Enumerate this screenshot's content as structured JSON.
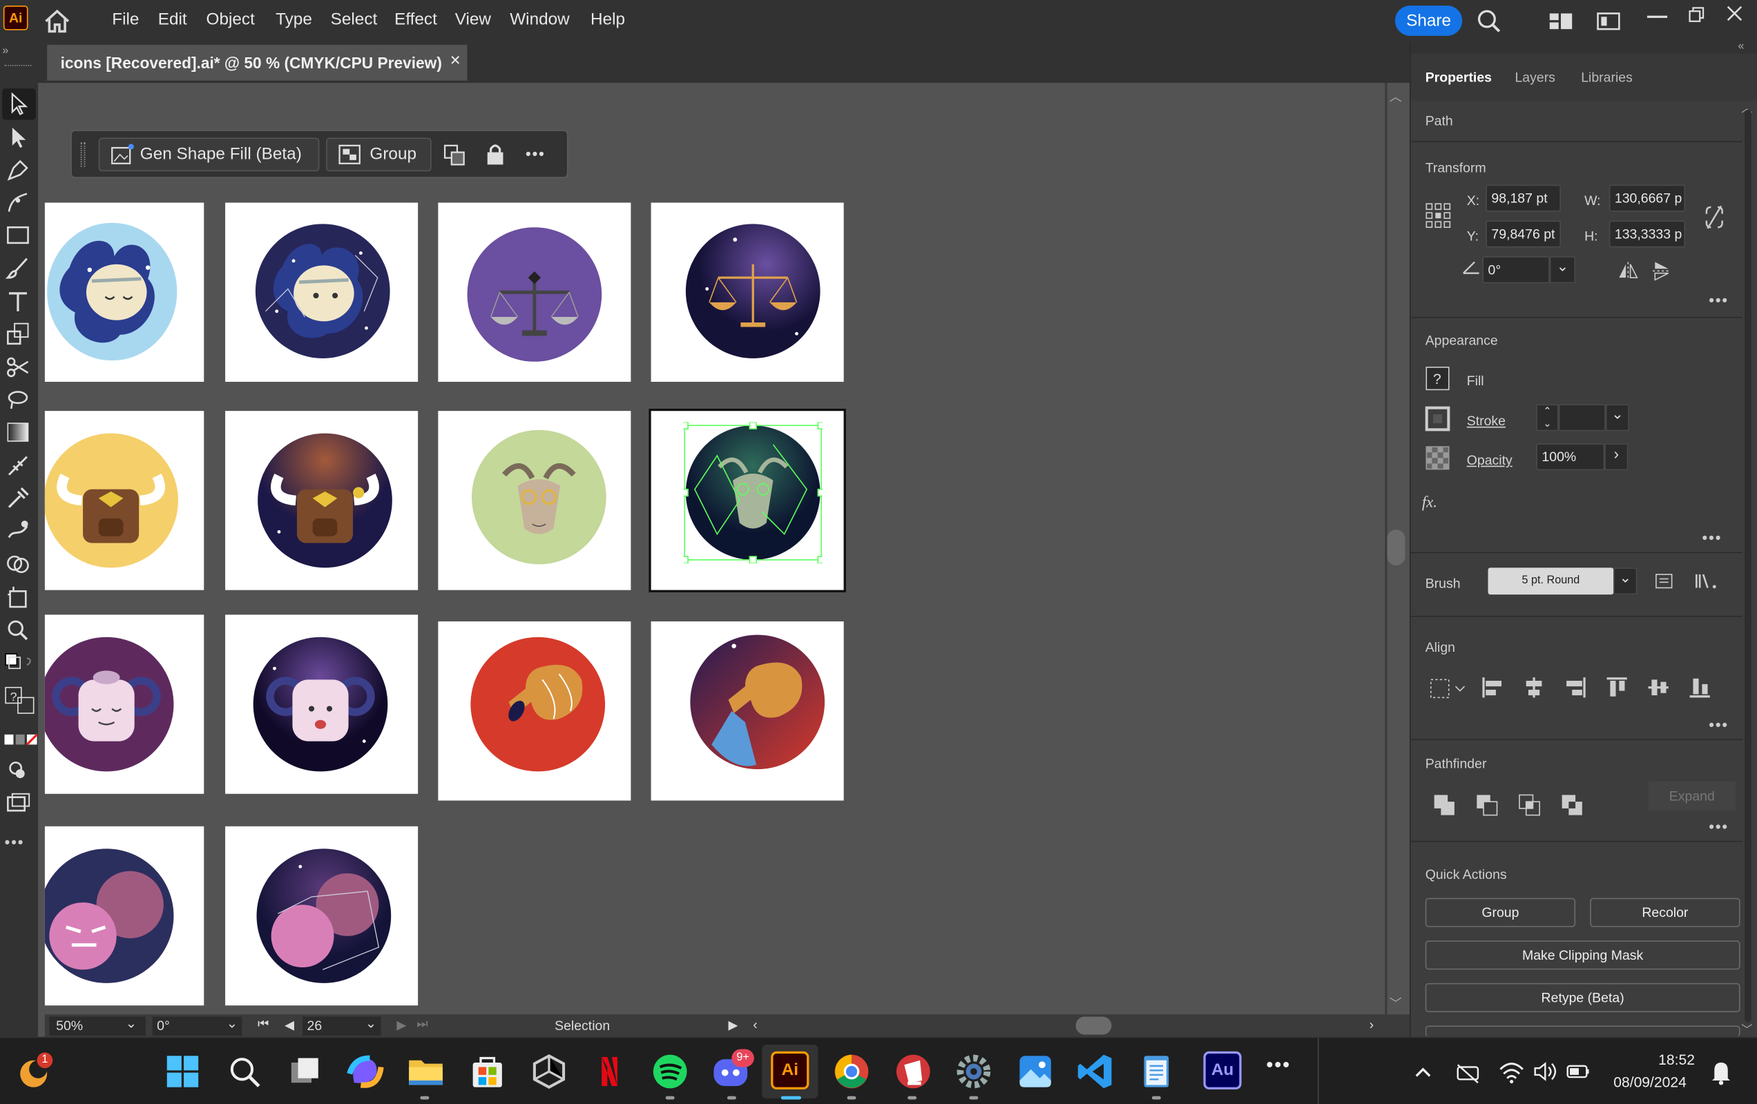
{
  "app": {
    "logo": "Ai",
    "home_icon": "home-icon"
  },
  "menu": [
    "File",
    "Edit",
    "Object",
    "Type",
    "Select",
    "Effect",
    "View",
    "Window",
    "Help"
  ],
  "header": {
    "share": "Share"
  },
  "doc_tab": {
    "title": "icons [Recovered].ai* @ 50 % (CMYK/CPU Preview)",
    "close": "×"
  },
  "context_bar": {
    "gen_shape_fill": "Gen Shape Fill (Beta)",
    "group": "Group",
    "more": "•••"
  },
  "artboards": [
    {
      "bg": "#a8d8f0",
      "fg": "#2a3d8f",
      "motif": "gemini"
    },
    {
      "bg": "#262659",
      "fg": "#2a3d8f",
      "motif": "gemini-night"
    },
    {
      "bg": "#6b4fa0",
      "fg": "#c9c9c9",
      "motif": "libra"
    },
    {
      "bg": "#2a1e52",
      "fg": "#e0a24a",
      "motif": "libra-night"
    },
    {
      "bg": "#f5cf6a",
      "fg": "#7a4a2a",
      "motif": "taurus"
    },
    {
      "bg": "#2b2255",
      "fg": "#7a4a2a",
      "motif": "taurus-night"
    },
    {
      "bg": "#c4d89a",
      "fg": "#c6b29a",
      "motif": "capricorn"
    },
    {
      "bg": "#163a3a",
      "fg": "#a7b59a",
      "motif": "capricorn-night"
    },
    {
      "bg": "#5e2a5e",
      "fg": "#f1d9e8",
      "motif": "aries"
    },
    {
      "bg": "#2b2050",
      "fg": "#f1d9e8",
      "motif": "aries-night"
    },
    {
      "bg": "#d63a2a",
      "fg": "#d99440",
      "motif": "aquarius"
    },
    {
      "bg": "#3a2a5a",
      "fg": "#d99440",
      "motif": "aquarius-night"
    },
    {
      "bg": "#2b2f5e",
      "fg": "#d97fb8",
      "motif": "pisces"
    },
    {
      "bg": "#232550",
      "fg": "#d97fb8",
      "motif": "pisces-night"
    }
  ],
  "status": {
    "zoom": "50%",
    "rotate": "0°",
    "artboard": "26",
    "tool": "Selection"
  },
  "panel": {
    "tabs": [
      "Properties",
      "Layers",
      "Libraries"
    ],
    "object_type": "Path",
    "transform": {
      "title": "Transform",
      "x_label": "X:",
      "x": "98,187 pt",
      "y_label": "Y:",
      "y": "79,8476 pt",
      "w_label": "W:",
      "w": "130,6667 p",
      "h_label": "H:",
      "h": "133,3333 p",
      "angle": "0°"
    },
    "appearance": {
      "title": "Appearance",
      "fill": "Fill",
      "stroke": "Stroke",
      "opacity_label": "Opacity",
      "opacity": "100%",
      "fx": "fx."
    },
    "brush": {
      "label": "Brush",
      "value": "5 pt. Round"
    },
    "align": {
      "title": "Align"
    },
    "pathfinder": {
      "title": "Pathfinder",
      "expand": "Expand"
    },
    "quick_actions": {
      "title": "Quick Actions",
      "group": "Group",
      "recolor": "Recolor",
      "clipping": "Make Clipping Mask",
      "retype": "Retype (Beta)"
    }
  },
  "taskbar": {
    "time": "18:52",
    "date": "08/09/2024",
    "discord_badge": "9+",
    "ai_label": "Ai",
    "au_label": "Au",
    "notif_badge": "1"
  }
}
